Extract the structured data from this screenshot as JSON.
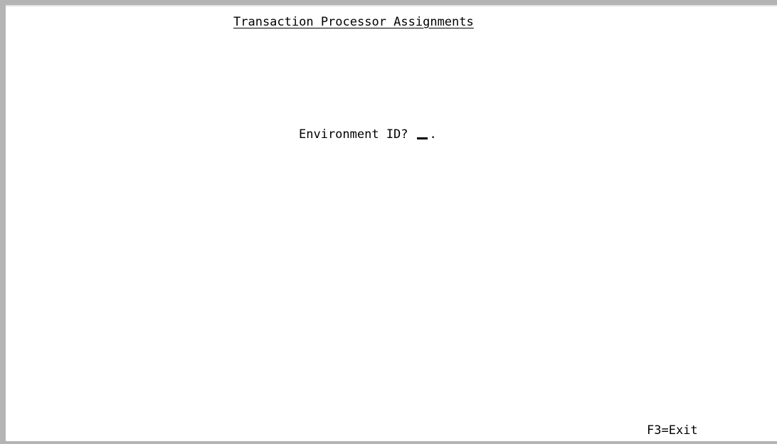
{
  "screen": {
    "title": "Transaction Processor Assignments"
  },
  "prompt": {
    "label": "Environment ID?",
    "value": "",
    "field_terminator": "."
  },
  "function_keys": {
    "f3": "F3=Exit"
  }
}
